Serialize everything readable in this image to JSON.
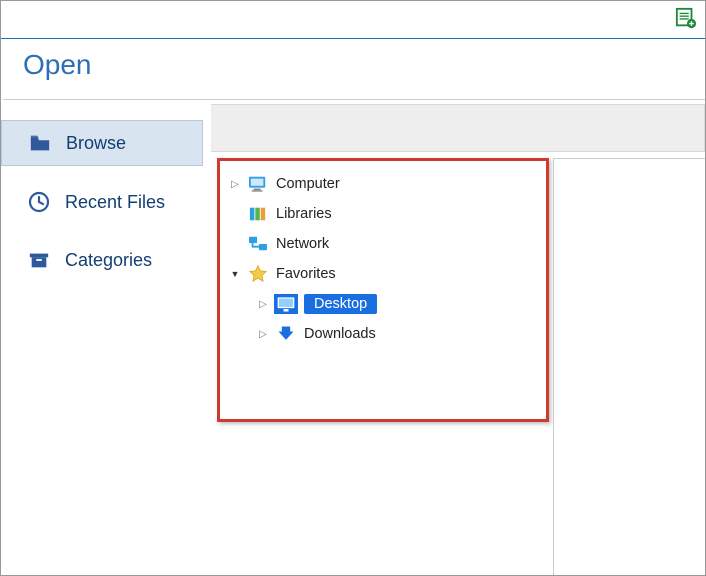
{
  "title": "Open",
  "sidebar": {
    "items": [
      {
        "label": "Browse",
        "icon": "folder-icon",
        "active": true
      },
      {
        "label": "Recent Files",
        "icon": "clock-icon",
        "active": false
      },
      {
        "label": "Categories",
        "icon": "archive-icon",
        "active": false
      }
    ]
  },
  "tree": {
    "nodes": [
      {
        "label": "Computer",
        "icon": "computer-icon",
        "expander": "right",
        "depth": 0,
        "selected": false
      },
      {
        "label": "Libraries",
        "icon": "libraries-icon",
        "expander": "",
        "depth": 0,
        "selected": false
      },
      {
        "label": "Network",
        "icon": "network-icon",
        "expander": "",
        "depth": 0,
        "selected": false
      },
      {
        "label": "Favorites",
        "icon": "star-icon",
        "expander": "down",
        "depth": 0,
        "selected": false
      },
      {
        "label": "Desktop",
        "icon": "desktop-icon",
        "expander": "right",
        "depth": 1,
        "selected": true
      },
      {
        "label": "Downloads",
        "icon": "download-icon",
        "expander": "right",
        "depth": 1,
        "selected": false
      }
    ]
  },
  "colors": {
    "accent": "#2e6eb6",
    "highlight": "#cf3a2e",
    "selection": "#1a6fe0"
  }
}
